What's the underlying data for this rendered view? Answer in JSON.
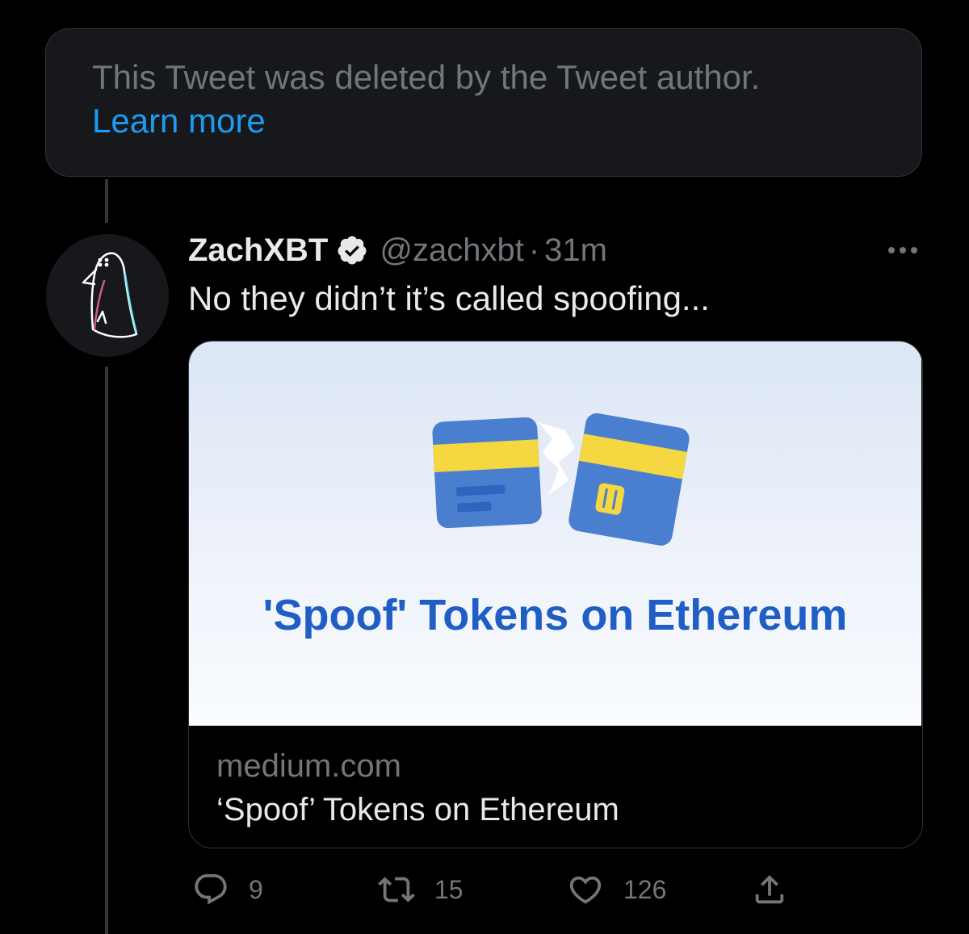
{
  "deleted_notice": {
    "message": "This Tweet was deleted by the Tweet author.",
    "link_label": "Learn more"
  },
  "tweet": {
    "author_name": "ZachXBT",
    "verified": true,
    "handle": "@zachxbt",
    "separator": "·",
    "time": "31m",
    "text": "No they didn’t it’s called spoofing...",
    "card": {
      "image_title": "'Spoof' Tokens on Ethereum",
      "domain": "medium.com",
      "title": "‘Spoof’ Tokens on Ethereum"
    },
    "actions": {
      "replies": "9",
      "retweets": "15",
      "likes": "126"
    }
  },
  "icons": {
    "more": "more-icon",
    "reply": "reply-icon",
    "retweet": "retweet-icon",
    "like": "heart-icon",
    "share": "share-icon",
    "verified": "verified-badge-icon"
  },
  "colors": {
    "background": "#000000",
    "link": "#1d9bf0",
    "secondary_text": "#71767b",
    "primary_text": "#e7e9ea",
    "card_title_blue": "#1f5ec4",
    "card_yellow": "#f5d742"
  }
}
